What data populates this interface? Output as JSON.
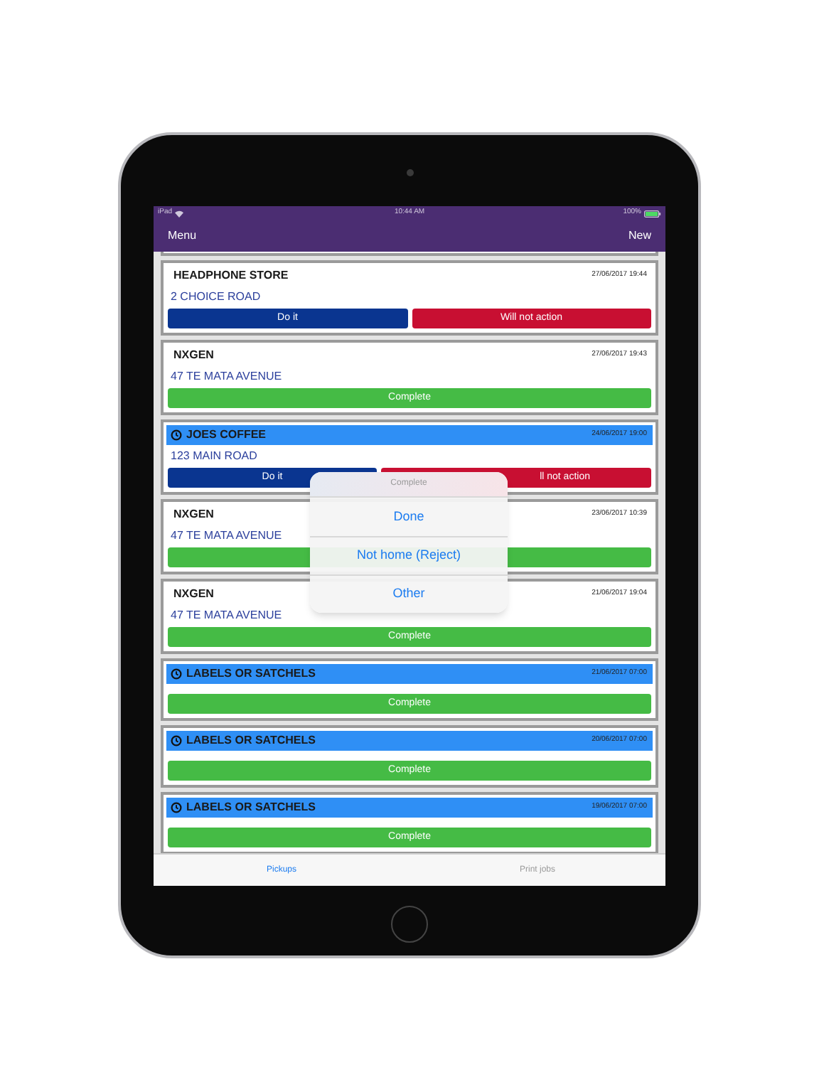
{
  "status_bar": {
    "device": "iPad",
    "time": "10:44 AM",
    "battery": "100%"
  },
  "nav_bar": {
    "left": "Menu",
    "right": "New"
  },
  "cards": [
    {
      "name": "HEADPHONE STORE",
      "date": "27/06/2017 19:44",
      "highlighted": false,
      "address": "2 CHOICE ROAD",
      "buttons": [
        {
          "kind": "do",
          "label": "Do it"
        },
        {
          "kind": "reject",
          "label": "Will not action"
        }
      ]
    },
    {
      "name": "NXGEN",
      "date": "27/06/2017 19:43",
      "highlighted": false,
      "address": "47 TE MATA AVENUE",
      "buttons": [
        {
          "kind": "complete",
          "label": "Complete"
        }
      ]
    },
    {
      "name": "JOES COFFEE",
      "date": "24/06/2017 19:00",
      "highlighted": true,
      "address": "123 MAIN ROAD",
      "buttons": [
        {
          "kind": "do",
          "label": "Do it"
        },
        {
          "kind": "reject",
          "label": "ll not action",
          "partly_covered": true
        }
      ]
    },
    {
      "name": "NXGEN",
      "date": "23/06/2017 10:39",
      "highlighted": false,
      "address": "47 TE MATA AVENUE",
      "buttons": [
        {
          "kind": "complete"
        }
      ]
    },
    {
      "name": "NXGEN",
      "date": "21/06/2017 19:04",
      "highlighted": false,
      "address": "47 TE MATA AVENUE",
      "buttons": [
        {
          "kind": "complete",
          "label": "Complete"
        }
      ]
    },
    {
      "name": "LABELS OR SATCHELS",
      "date": "21/06/2017 07:00",
      "highlighted": true,
      "buttons": [
        {
          "kind": "complete",
          "label": "Complete"
        }
      ]
    },
    {
      "name": "LABELS OR SATCHELS",
      "date": "20/06/2017 07:00",
      "highlighted": true,
      "buttons": [
        {
          "kind": "complete",
          "label": "Complete"
        }
      ]
    },
    {
      "name": "LABELS OR SATCHELS",
      "date": "19/06/2017 07:00",
      "highlighted": true,
      "buttons": [
        {
          "kind": "complete",
          "label": "Complete"
        }
      ]
    }
  ],
  "action_sheet": {
    "title": "Complete",
    "options": [
      "Done",
      "Not home (Reject)",
      "Other"
    ]
  },
  "tabs": [
    {
      "label": "Pickups",
      "selected": true
    },
    {
      "label": "Print jobs",
      "selected": false
    }
  ]
}
